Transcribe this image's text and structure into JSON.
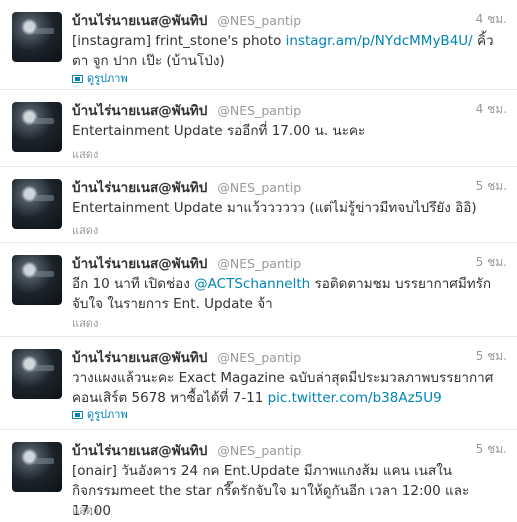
{
  "tweets": [
    {
      "name": "บ้านไร่นายเนส@พันทิป",
      "handle": "@NES_pantip",
      "time": "4 ชม.",
      "text_before": "[instagram] frint_stone's photo ",
      "link": "instagr.am/p/NYdcMMyB4U/",
      "text_after": " คิ้ว ตา จูก ปาก เป๊ะ (บ้านโป่ง)",
      "action": "ดูรูปภาพ",
      "action_icon": "photo-icon"
    },
    {
      "name": "บ้านไร่นายเนส@พันทิป",
      "handle": "@NES_pantip",
      "time": "4 ชม.",
      "text_before": "Entertainment Update รออีกที่ 17.00 น. นะคะ",
      "link": "",
      "text_after": "",
      "action": "แสดง"
    },
    {
      "name": "บ้านไร่นายเนส@พันทิป",
      "handle": "@NES_pantip",
      "time": "5 ชม.",
      "text_before": "Entertainment Update มาแว้วววววว (แต่ไม่รู้ข่าวมีทจบไปรึยัง อิอิ)",
      "link": "",
      "text_after": "",
      "action": "แสดง"
    },
    {
      "name": "บ้านไร่นายเนส@พันทิป",
      "handle": "@NES_pantip",
      "time": "5 ชม.",
      "text_before": "อีก 10 นาที เปิดช่อง ",
      "link": "@ACTSchannelth",
      "text_after": " รอติดตามชม บรรยากาศมีทรักจับใจ ในรายการ Ent. Update จ้า",
      "action": "แสดง"
    },
    {
      "name": "บ้านไร่นายเนส@พันทิป",
      "handle": "@NES_pantip",
      "time": "5 ชม.",
      "text_before": "วางแผงแล้วนะคะ Exact Magazine ฉบับล่าสุดมีประมวลภาพบรรยากาศ คอนเสิร์ต 5678 หาซื้อได้ที่ 7-11 ",
      "link": "pic.twitter.com/b38Az5U9",
      "text_after": "",
      "action": "ดูรูปภาพ",
      "action_icon": "photo-icon"
    },
    {
      "name": "บ้านไร่นายเนส@พันทิป",
      "handle": "@NES_pantip",
      "time": "5 ชม.",
      "text_before": "[onair] วันอังคาร 24 กค Ent.Update มีภาพแกงส้ม แคน เนสในกิจกรรมmeet the star กรี๊ดรักจับใจ มาให้ดูกันอีก เวลา 12:00 และ 17:00",
      "link": "",
      "text_after": "",
      "action": "แสดง"
    }
  ]
}
